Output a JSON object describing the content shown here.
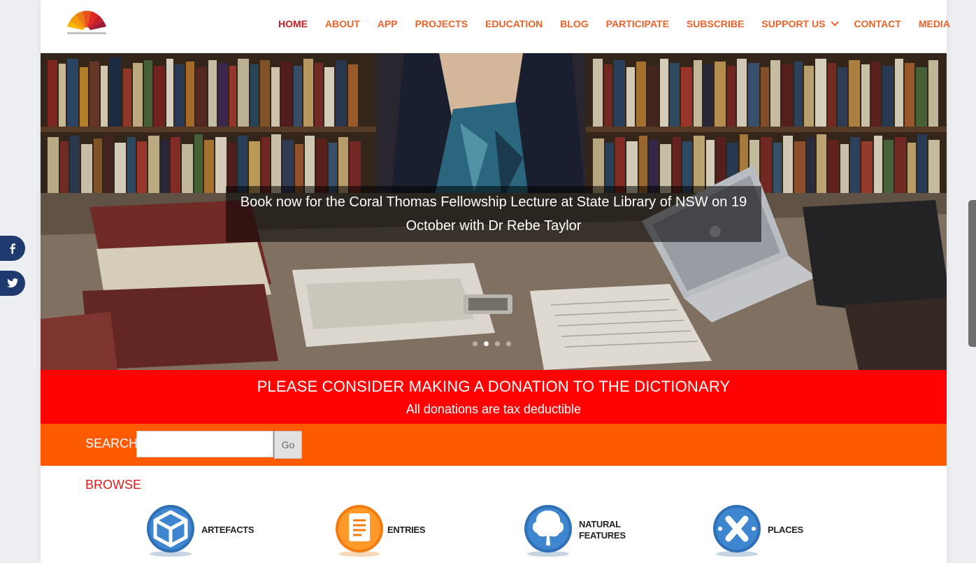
{
  "header": {
    "logo_alt": "dictionaryofsydney.org",
    "nav": [
      {
        "label": "HOME",
        "active": true
      },
      {
        "label": "ABOUT"
      },
      {
        "label": "APP"
      },
      {
        "label": "PROJECTS"
      },
      {
        "label": "EDUCATION"
      },
      {
        "label": "BLOG"
      },
      {
        "label": "PARTICIPATE"
      },
      {
        "label": "SUBSCRIBE"
      },
      {
        "label": "SUPPORT US",
        "has_dropdown": true
      },
      {
        "label": "CONTACT"
      },
      {
        "label": "MEDIA"
      }
    ]
  },
  "hero": {
    "caption": "Book now for the Coral Thomas Fellowship Lecture at State Library of NSW on 19 October with Dr Rebe Taylor",
    "slides_count": 4,
    "active_slide": 2
  },
  "donation": {
    "title": "PLEASE CONSIDER MAKING A DONATION TO THE DICTIONARY",
    "subtitle": "All donations are tax deductible"
  },
  "search": {
    "label": "SEARCH",
    "value": "",
    "placeholder": "",
    "button": "Go"
  },
  "browse": {
    "label": "BROWSE",
    "items": [
      {
        "label": "ARTEFACTS",
        "icon": "cube-icon"
      },
      {
        "label": "ENTRIES",
        "icon": "document-icon"
      },
      {
        "label": "NATURAL",
        "label2": "FEATURES",
        "icon": "tree-icon"
      },
      {
        "label": "PLACES",
        "icon": "cross-icon"
      }
    ]
  },
  "social": [
    {
      "icon": "facebook-icon"
    },
    {
      "icon": "twitter-icon"
    }
  ],
  "colors": {
    "nav": "#e8622a",
    "nav_active": "#c01d21",
    "donation_bg": "#fd0303",
    "search_bg": "#fd5a02",
    "social_bg": "#1e3a6e"
  }
}
